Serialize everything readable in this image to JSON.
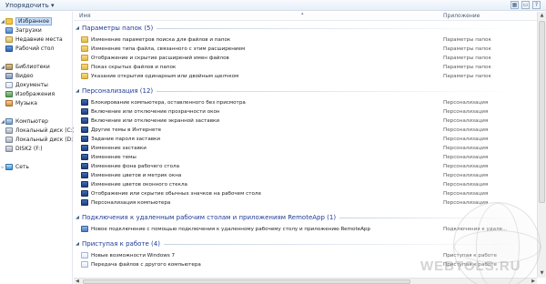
{
  "toolbar": {
    "organize_label": "Упорядочить ▾",
    "icons": [
      "view-icon",
      "preview-pane-icon",
      "help-icon"
    ]
  },
  "nav": {
    "favorites": "Избранное",
    "downloads": "Загрузки",
    "recent_places": "Недавние места",
    "desktop": "Рабочий стол",
    "libraries": "Библиотеки",
    "video": "Видео",
    "documents": "Документы",
    "pictures": "Изображения",
    "music": "Музыка",
    "computer": "Компьютер",
    "disk_c": "Локальный диск (C:)",
    "disk_d": "Локальный диск (D:)",
    "disk_f": "DISK2 (F:)",
    "network": "Сеть"
  },
  "columns": {
    "name": "Имя",
    "type": "Приложение"
  },
  "groups": {
    "folder_options": "Параметры папок (5)",
    "personalization": "Персонализация (12)",
    "remoteapp": "Подключения к удаленным рабочим столам и приложениям RemoteApp (1)",
    "getting_started": "Приступая к работе (4)"
  },
  "rows": {
    "folder_options": [
      {
        "name": "Изменение параметров поиска для файлов и папок",
        "type": "Параметры папок"
      },
      {
        "name": "Изменение типа файла, связанного с этим расширением",
        "type": "Параметры папок"
      },
      {
        "name": "Отображение и скрытие расширений имен файлов",
        "type": "Параметры папок"
      },
      {
        "name": "Показ скрытых файлов и папок",
        "type": "Параметры папок"
      },
      {
        "name": "Указание открытия одинарным или двойным щелчком",
        "type": "Параметры папок"
      }
    ],
    "personalization": [
      {
        "name": "Блокирование компьютера, оставленного без присмотра",
        "type": "Персонализация"
      },
      {
        "name": "Включение или отключение прозрачности окон",
        "type": "Персонализация"
      },
      {
        "name": "Включение или отключение экранной заставки",
        "type": "Персонализация"
      },
      {
        "name": "Другие темы в Интернете",
        "type": "Персонализация"
      },
      {
        "name": "Задание пароля заставки",
        "type": "Персонализация"
      },
      {
        "name": "Изменение заставки",
        "type": "Персонализация"
      },
      {
        "name": "Изменение темы",
        "type": "Персонализация"
      },
      {
        "name": "Изменение фона рабочего стола",
        "type": "Персонализация"
      },
      {
        "name": "Изменение цветов и метрик окна",
        "type": "Персонализация"
      },
      {
        "name": "Изменение цветов оконного стекла",
        "type": "Персонализация"
      },
      {
        "name": "Отображение или скрытие обычных значков на рабочем столе",
        "type": "Персонализация"
      },
      {
        "name": "Персонализация компьютера",
        "type": "Персонализация"
      }
    ],
    "remoteapp": [
      {
        "name": "Новое подключение с помощью подключения к удаленному рабочему столу и приложению RemoteApp",
        "type": "Подключения к удале..."
      }
    ],
    "getting_started": [
      {
        "name": "Новые возможности Windows 7",
        "type": "Приступая к работе"
      },
      {
        "name": "Передача файлов с другого компьютера",
        "type": "Приступая к работе"
      }
    ]
  },
  "watermark": "WEBTOLS.RU"
}
